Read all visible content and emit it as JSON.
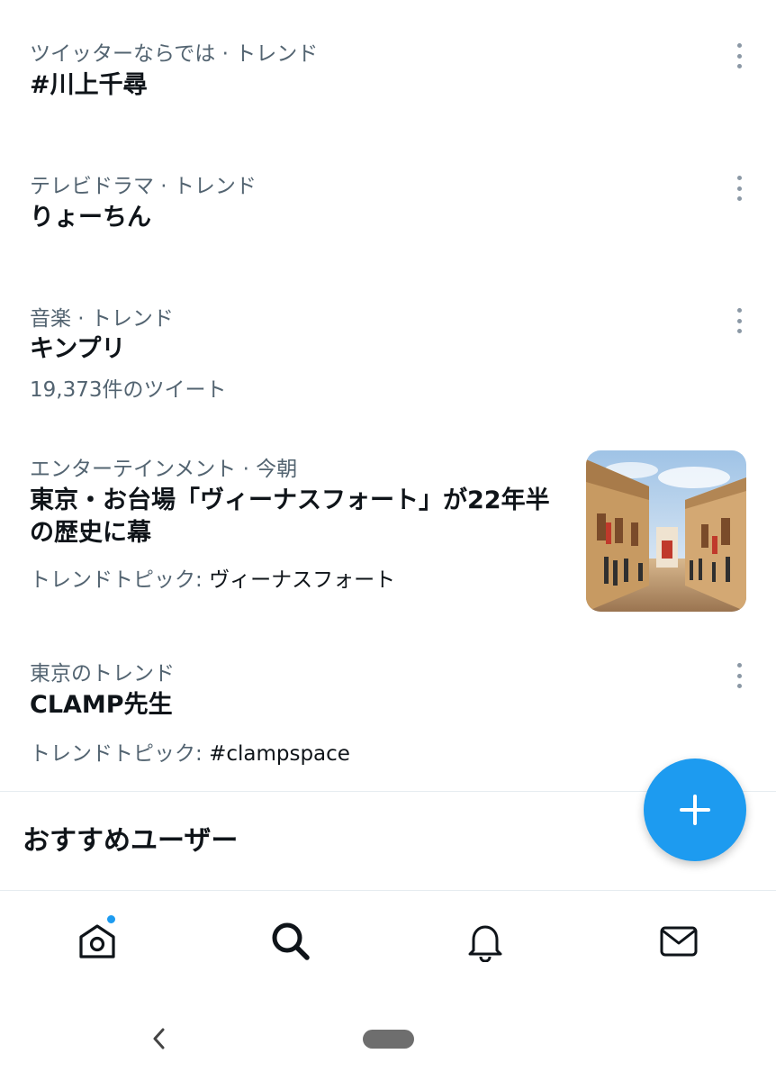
{
  "trends": [
    {
      "context": "ツイッターならでは · トレンド",
      "headline": "#川上千尋",
      "sub": ""
    },
    {
      "context": "テレビドラマ · トレンド",
      "headline": "りょーちん",
      "sub": ""
    },
    {
      "context": "音楽 · トレンド",
      "headline": "キンプリ",
      "sub": "19,373件のツイート"
    },
    {
      "context": "エンターテインメント · 今朝",
      "headline_line1": "東京・お台場「ヴィーナスフォート」が22年半",
      "headline_line2": "の歴史に幕",
      "sub_label": "トレンドトピック: ",
      "sub_value": "ヴィーナスフォート"
    },
    {
      "context": "東京のトレンド",
      "headline": "CLAMP先生",
      "sub_label": "トレンドトピック: ",
      "sub_value": "#clampspace"
    }
  ],
  "section": {
    "title": "おすすめユーザー"
  },
  "fab": {
    "icon": "plus-icon",
    "color": "#1d9bf0"
  },
  "tabbar": {
    "items": [
      {
        "icon": "home-icon",
        "has_badge": true
      },
      {
        "icon": "search-icon",
        "active": true
      },
      {
        "icon": "bell-icon"
      },
      {
        "icon": "mail-icon"
      }
    ]
  },
  "colors": {
    "accent": "#1d9bf0",
    "secondary_text": "#536471",
    "primary_text": "#0f1419"
  }
}
